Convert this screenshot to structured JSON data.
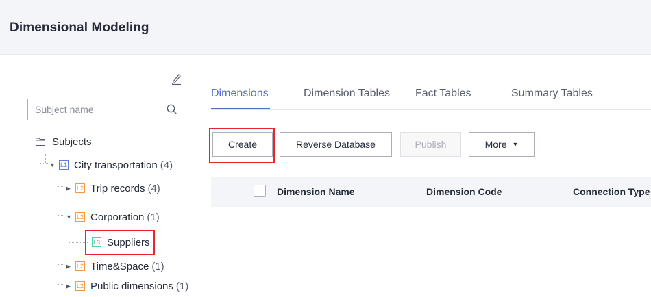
{
  "header": {
    "title": "Dimensional Modeling"
  },
  "left_panel": {
    "search": {
      "placeholder": "Subject name"
    },
    "tree": {
      "root": {
        "label": "Subjects"
      },
      "l1": {
        "badge": "L1",
        "label": "City transportation",
        "count": "(4)"
      },
      "l2_trip": {
        "badge": "L2",
        "label": "Trip records",
        "count": "(4)"
      },
      "l2_corp": {
        "badge": "L2",
        "label": "Corporation",
        "count": "(1)"
      },
      "l3_supp": {
        "badge": "L3",
        "label": "Suppliers"
      },
      "l2_time": {
        "badge": "L2",
        "label": "Time&Space",
        "count": "(1)"
      },
      "l2_public": {
        "badge": "L2",
        "label": "Public dimensions",
        "count": "(1)"
      }
    }
  },
  "tabs": {
    "dimensions": "Dimensions",
    "dimension_tables": "Dimension Tables",
    "fact_tables": "Fact Tables",
    "summary_tables": "Summary Tables"
  },
  "toolbar": {
    "create": "Create",
    "reverse_database": "Reverse Database",
    "publish": "Publish",
    "more": "More"
  },
  "table": {
    "columns": [
      "Dimension Name",
      "Dimension Code",
      "Connection Type"
    ]
  },
  "colors": {
    "accent": "#526ecc",
    "highlight": "#e3272d",
    "l1": "#5e7ce0",
    "l2": "#fa9841",
    "l3": "#50d4ab"
  }
}
